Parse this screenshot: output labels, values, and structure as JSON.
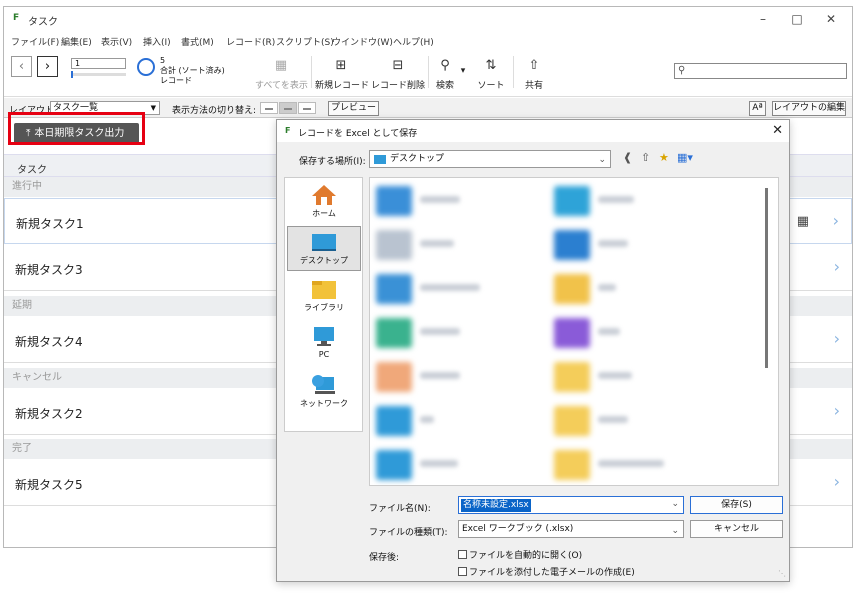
{
  "window": {
    "title": "タスク"
  },
  "menu": [
    "ファイル(F)",
    "編集(E)",
    "表示(V)",
    "挿入(I)",
    "書式(M)",
    "レコード(R)",
    "スクリプト(S)",
    "ウインドウ(W)",
    "ヘルプ(H)"
  ],
  "toolbar": {
    "record_number": "1",
    "total": "5",
    "total_label": "合計 (ソート済み)",
    "records_label": "レコード",
    "show_all": "すべてを表示",
    "new_record": "新規レコード",
    "delete_record": "レコード削除",
    "find": "検索",
    "sort": "ソート",
    "share": "共有"
  },
  "layoutbar": {
    "layout_label": "レイアウト:",
    "layout_value": "タスク一覧",
    "view_as_label": "表示方法の切り替え:",
    "preview": "プレビュー",
    "aa": "Aª",
    "edit_layout": "レイアウトの編集"
  },
  "header": {
    "export_button": "本日期限タスク出力"
  },
  "list": {
    "column": "タスク",
    "groups": [
      {
        "label": "進行中",
        "rows": [
          "新規タスク1",
          "新規タスク3"
        ]
      },
      {
        "label": "延期",
        "rows": [
          "新規タスク4"
        ]
      },
      {
        "label": "キャンセル",
        "rows": [
          "新規タスク2"
        ]
      },
      {
        "label": "完了",
        "rows": [
          "新規タスク5"
        ]
      }
    ]
  },
  "dialog": {
    "title": "レコードを Excel として保存",
    "save_in_label": "保存する場所(I):",
    "save_in_value": "デスクトップ",
    "places": [
      "ホーム",
      "デスクトップ",
      "ライブラリ",
      "PC",
      "ネットワーク"
    ],
    "filename_label": "ファイル名(N):",
    "filename_value": "名称未設定.xlsx",
    "filetype_label": "ファイルの種類(T):",
    "filetype_value": "Excel ワークブック (.xlsx)",
    "save_button": "保存(S)",
    "cancel_button": "キャンセル",
    "after_save_label": "保存後:",
    "open_automatically": "ファイルを自動的に開く(O)",
    "create_email": "ファイルを添付した電子メールの作成(E)"
  },
  "colors": {
    "accent": "#2a6fd6",
    "highlight_box": "#e60012",
    "button_dark": "#555555"
  }
}
